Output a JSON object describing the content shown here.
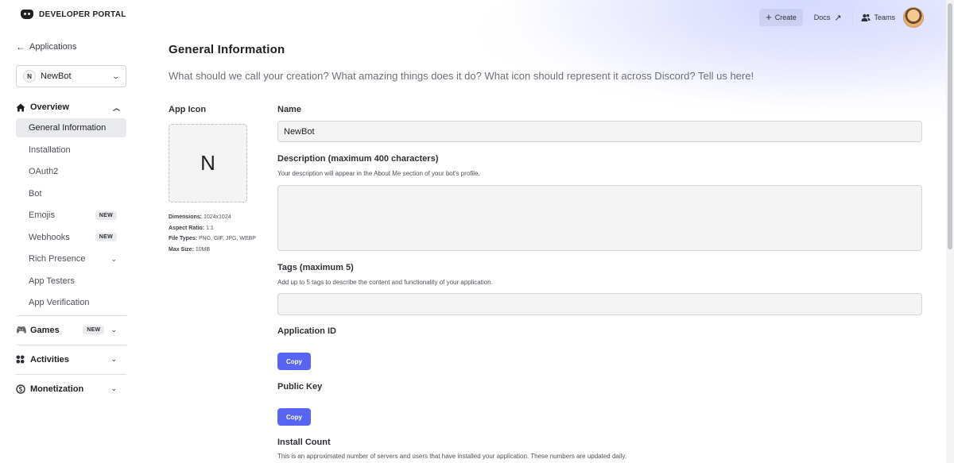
{
  "header": {
    "logo_text": "DEVELOPER PORTAL",
    "create_label": "Create",
    "docs_label": "Docs",
    "teams_label": "Teams"
  },
  "sidebar": {
    "back_label": "Applications",
    "app_initial": "N",
    "app_name": "NewBot",
    "overview": {
      "label": "Overview",
      "items": [
        {
          "label": "General Information"
        },
        {
          "label": "Installation"
        },
        {
          "label": "OAuth2"
        },
        {
          "label": "Bot"
        },
        {
          "label": "Emojis",
          "badge": "NEW"
        },
        {
          "label": "Webhooks",
          "badge": "NEW"
        },
        {
          "label": "Rich Presence"
        },
        {
          "label": "App Testers"
        },
        {
          "label": "App Verification"
        }
      ]
    },
    "groups": [
      {
        "label": "Games",
        "badge": "NEW"
      },
      {
        "label": "Activities"
      },
      {
        "label": "Monetization"
      }
    ]
  },
  "main": {
    "title": "General Information",
    "subtitle": "What should we call your creation? What amazing things does it do? What icon should represent it across Discord? Tell us here!",
    "app_icon": {
      "label": "App Icon",
      "initial": "N",
      "meta": [
        {
          "key": "Dimensions:",
          "value": "1024x1024"
        },
        {
          "key": "Aspect Ratio:",
          "value": "1:1"
        },
        {
          "key": "File Types:",
          "value": "PNG, GIF, JPG, WEBP"
        },
        {
          "key": "Max Size:",
          "value": "10MB"
        }
      ]
    },
    "name": {
      "label": "Name",
      "value": "NewBot"
    },
    "description": {
      "label": "Description (maximum 400 characters)",
      "hint": "Your description will appear in the About Me section of your bot's profile.",
      "value": ""
    },
    "tags": {
      "label": "Tags (maximum 5)",
      "hint": "Add up to 5 tags to describe the content and functionality of your application.",
      "value": ""
    },
    "application_id": {
      "label": "Application ID",
      "copy_label": "Copy"
    },
    "public_key": {
      "label": "Public Key",
      "copy_label": "Copy"
    },
    "install_count": {
      "label": "Install Count",
      "hint": "This is an approximated number of servers and users that have installed your application. These numbers are updated daily."
    }
  }
}
